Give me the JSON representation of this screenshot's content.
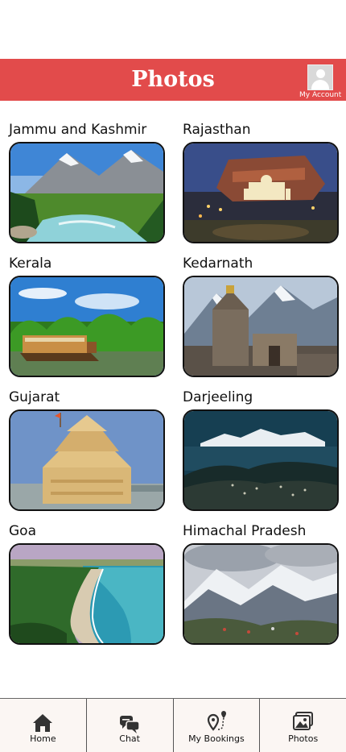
{
  "header": {
    "title": "Photos",
    "account_label": "My Account"
  },
  "destinations": [
    {
      "name": "Jammu and Kashmir"
    },
    {
      "name": "Rajasthan"
    },
    {
      "name": "Kerala"
    },
    {
      "name": "Kedarnath"
    },
    {
      "name": "Gujarat"
    },
    {
      "name": "Darjeeling"
    },
    {
      "name": "Goa"
    },
    {
      "name": "Himachal Pradesh"
    }
  ],
  "nav": {
    "items": [
      {
        "label": "Home",
        "icon": "home-icon"
      },
      {
        "label": "Chat",
        "icon": "chat-icon"
      },
      {
        "label": "My Bookings",
        "icon": "map-pin-icon"
      },
      {
        "label": "Photos",
        "icon": "photos-icon"
      }
    ]
  },
  "colors": {
    "header": "#e24b4b",
    "navbar": "#fbf6f3"
  }
}
